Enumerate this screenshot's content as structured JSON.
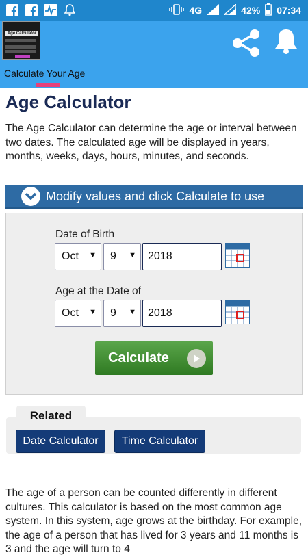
{
  "status_bar": {
    "icons_left": [
      "facebook-icon",
      "facebook-icon",
      "activity-icon",
      "bell-icon"
    ],
    "network": "4G",
    "battery": "42%",
    "time": "07:34"
  },
  "app_bar": {
    "logo_text": "Age Calculator",
    "tab_label": "Calculate Your Age",
    "colors": {
      "bar": "#3ba3ed",
      "status": "#1f86cc",
      "tab_indicator": "#e8407a"
    }
  },
  "page": {
    "title": "Age Calculator",
    "intro": "The Age Calculator can determine the age or interval between two dates. The calculated age will be displayed in years, months, weeks, days, hours, minutes, and seconds.",
    "banner": "Modify values and click Calculate to use"
  },
  "form": {
    "birth": {
      "label": "Date of Birth",
      "month": "Oct",
      "day": "9",
      "year": "2018"
    },
    "at_date": {
      "label": "Age at the Date of",
      "month": "Oct",
      "day": "9",
      "year": "2018"
    },
    "calculate_label": "Calculate"
  },
  "related": {
    "heading": "Related",
    "links": [
      "Date Calculator",
      "Time Calculator"
    ]
  },
  "body_text": "The age of a person can be counted differently in different cultures. This calculator is based on the most common age system. In this system, age grows at the birthday. For example, the age of a person that has lived for 3 years and 11 months is 3 and the age will turn to 4"
}
